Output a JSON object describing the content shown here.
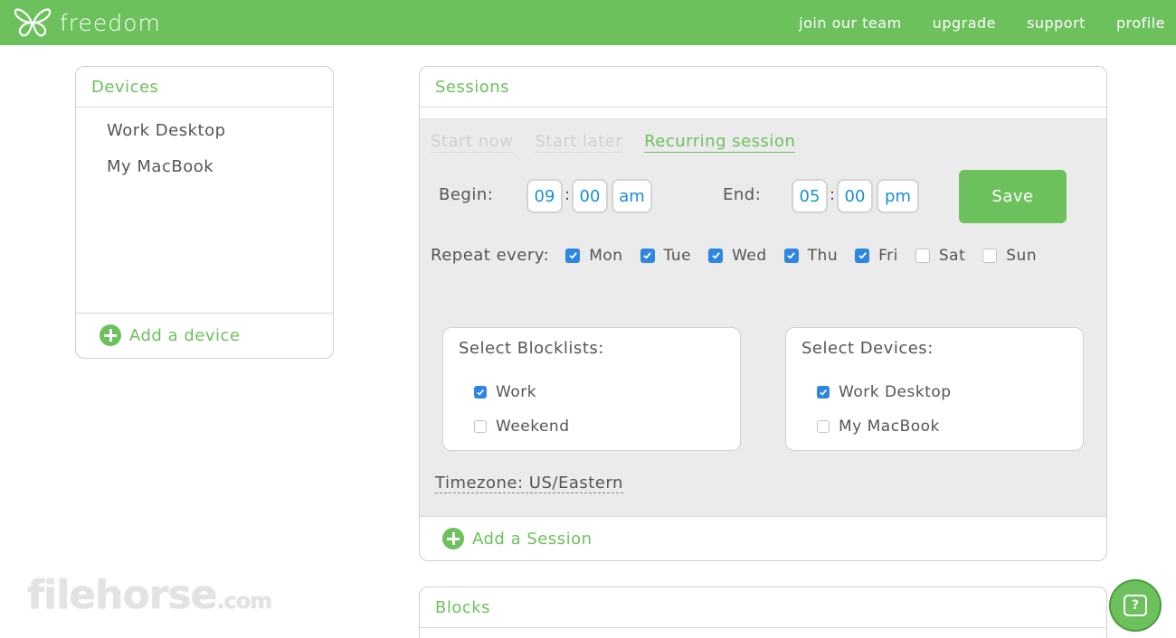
{
  "app": {
    "name": "freedom",
    "brand_color": "#6cc15c",
    "checkbox_color": "#2f86e0"
  },
  "nav": {
    "items": [
      "join our team",
      "upgrade",
      "support",
      "profile"
    ]
  },
  "devices": {
    "title": "Devices",
    "items": [
      "Work Desktop",
      "My MacBook"
    ],
    "add_label": "Add a device"
  },
  "sessions": {
    "title": "Sessions",
    "tabs": [
      "Start now",
      "Start later",
      "Recurring session"
    ],
    "active_tab": "Recurring session",
    "begin": {
      "label": "Begin:",
      "hour": "09",
      "minute": "00",
      "ampm": "am"
    },
    "end": {
      "label": "End:",
      "hour": "05",
      "minute": "00",
      "ampm": "pm"
    },
    "save_label": "Save",
    "repeat_label": "Repeat every:",
    "days": [
      {
        "label": "Mon",
        "checked": true
      },
      {
        "label": "Tue",
        "checked": true
      },
      {
        "label": "Wed",
        "checked": true
      },
      {
        "label": "Thu",
        "checked": true
      },
      {
        "label": "Fri",
        "checked": true
      },
      {
        "label": "Sat",
        "checked": false
      },
      {
        "label": "Sun",
        "checked": false
      }
    ],
    "blocklists": {
      "title": "Select Blocklists:",
      "items": [
        {
          "label": "Work",
          "checked": true
        },
        {
          "label": "Weekend",
          "checked": false
        }
      ]
    },
    "select_devices": {
      "title": "Select Devices:",
      "items": [
        {
          "label": "Work Desktop",
          "checked": true
        },
        {
          "label": "My MacBook",
          "checked": false
        }
      ]
    },
    "timezone": "Timezone: US/Eastern",
    "add_label": "Add a Session"
  },
  "blocks": {
    "title": "Blocks"
  },
  "watermark": {
    "main": "filehorse",
    "suffix": ".com"
  },
  "help": {
    "label": "?"
  }
}
